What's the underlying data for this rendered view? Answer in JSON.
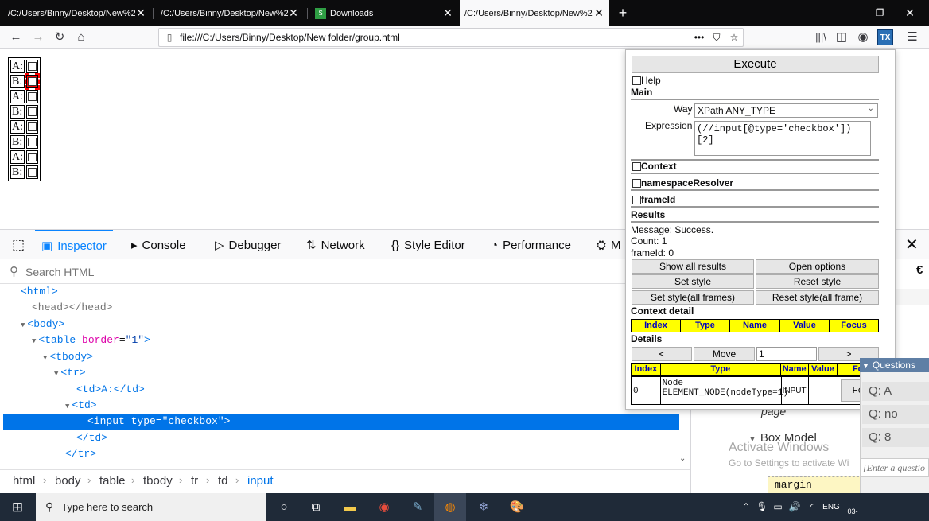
{
  "tabs": [
    {
      "title": "/C:/Users/Binny/Desktop/New%20f",
      "active": false
    },
    {
      "title": "/C:/Users/Binny/Desktop/New%20f",
      "active": false
    },
    {
      "title": "Downloads",
      "active": false
    },
    {
      "title": "/C:/Users/Binny/Desktop/New%20f",
      "active": true
    }
  ],
  "url": "file:///C:/Users/Binny/Desktop/New folder/group.html",
  "page_rows": [
    "A:",
    "B:",
    "A:",
    "B:",
    "A:",
    "B:",
    "A:",
    "B:"
  ],
  "devtools": {
    "tabs": [
      "Inspector",
      "Console",
      "Debugger",
      "Network",
      "Style Editor",
      "Performance",
      "M"
    ],
    "search_placeholder": "Search HTML",
    "markup": {
      "html": "<html>",
      "head": "<head></head>",
      "body": "<body>",
      "table_open": "<table ",
      "table_attr": "border",
      "table_val": "\"1\"",
      "tbody": "<tbody>",
      "tr": "<tr>",
      "td_text": "<td>A:</td>",
      "td": "<td>",
      "input": "<input type=\"checkbox\">",
      "td_close": "</td>",
      "tr_close": "</tr>"
    },
    "breadcrumb": [
      "html",
      "body",
      "table",
      "tbody",
      "tr",
      "td",
      "input"
    ],
    "side": {
      "page_label": "page",
      "box_model": "Box Model",
      "margin": "margin"
    }
  },
  "popup": {
    "execute": "Execute",
    "help": "Help",
    "main": "Main",
    "way_label": "Way",
    "way_value": "XPath ANY_TYPE",
    "expression_label": "Expression",
    "expression_value": "(//input[@type='checkbox'])[2]",
    "context": "Context",
    "namespace": "namespaceResolver",
    "frameid": "frameId",
    "results": "Results",
    "message": "Message: Success.",
    "count": "Count: 1",
    "frameid_val": "frameId: 0",
    "btn_show_all": "Show all results",
    "btn_open_options": "Open options",
    "btn_set_style": "Set style",
    "btn_reset_style": "Reset style",
    "btn_set_style_all": "Set style(all frames)",
    "btn_reset_style_all": "Reset style(all frame)",
    "context_detail": "Context detail",
    "ctx_cols": [
      "Index",
      "Type",
      "Name",
      "Value",
      "Focus"
    ],
    "details": "Details",
    "prev": "<",
    "move": "Move",
    "move_value": "1",
    "next": ">",
    "det_cols": [
      "Index",
      "Type",
      "Name",
      "Value",
      "Fo"
    ],
    "det_row": {
      "index": "0",
      "type": "Node ELEMENT_NODE(nodeType=1)",
      "name": "INPUT",
      "focus": "Fo"
    }
  },
  "questions": {
    "title": "Questions",
    "items": [
      "Q: A",
      "Q: no",
      "Q: 8"
    ],
    "input_placeholder": "[Enter a questio"
  },
  "watermark": {
    "line1": "Activate Windows",
    "line2": "Go to Settings to activate Wi"
  },
  "taskbar": {
    "search_placeholder": "Type here to search",
    "lang": "ENG",
    "date": "03-"
  },
  "colors": {
    "accent": "#0074e8",
    "highlight": "#ff0000",
    "detail_header": "#ffff00"
  }
}
